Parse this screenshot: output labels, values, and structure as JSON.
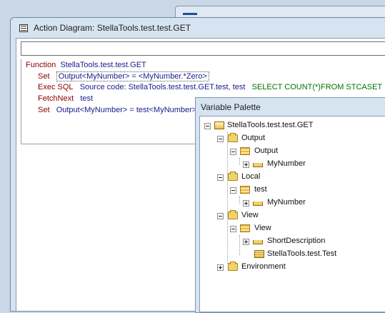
{
  "window": {
    "title": "Action Diagram: StellaTools.test.test.GET"
  },
  "code": {
    "function_kw": "Function",
    "function_name": "StellaTools.test.test.GET",
    "line1_kw": "Set",
    "line1_text": "Output<MyNumber> = <MyNumber.*Zero>",
    "line2_kw": "Exec SQL",
    "line2_text": "Source code: StellaTools.test.test.GET.test, test",
    "line2_sql": "SELECT COUNT(*)FROM STCASET",
    "line3_kw": "FetchNext",
    "line3_text": "test",
    "line4_kw": "Set",
    "line4_text": "Output<MyNumber> = test<MyNumber>"
  },
  "palette": {
    "title": "Variable Palette",
    "root": "StellaTools.test.test.GET",
    "output": "Output",
    "output_child": "Output",
    "output_field": "MyNumber",
    "local": "Local",
    "local_child": "test",
    "local_field": "MyNumber",
    "view": "View",
    "view_child": "View",
    "view_field1": "ShortDescription",
    "view_field2": "StellaTools.test.Test",
    "environment": "Environment"
  },
  "icons": [
    "window-icon",
    "function-icon",
    "folder-icon",
    "structure-icon",
    "field-icon",
    "table-icon"
  ]
}
